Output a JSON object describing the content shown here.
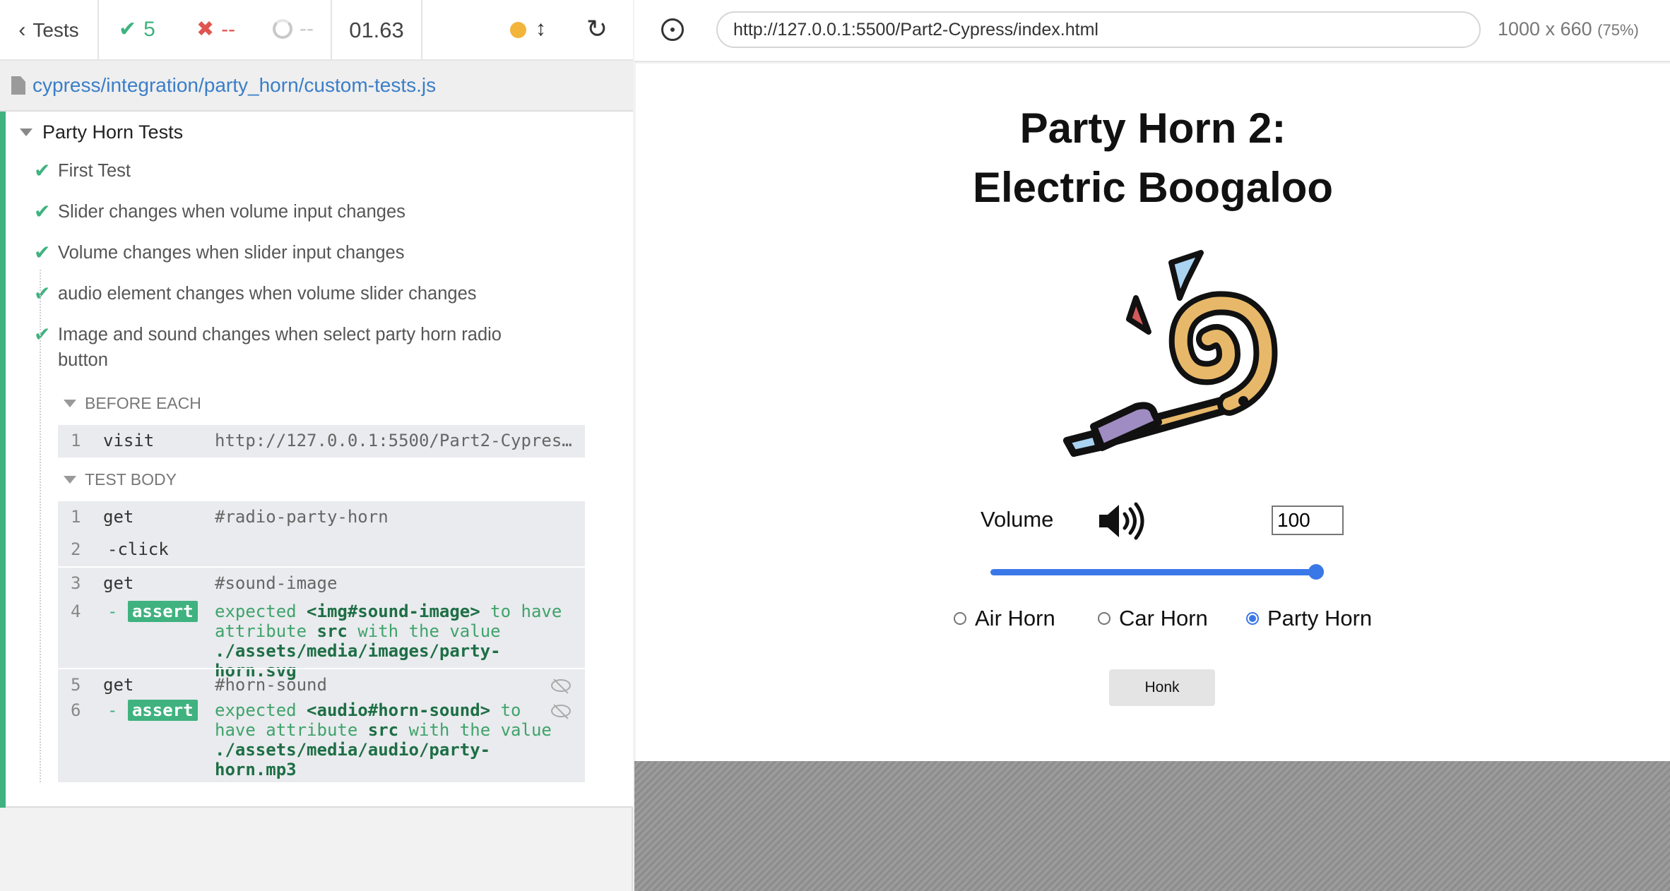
{
  "topbar": {
    "tests_label": "Tests",
    "passed": "5",
    "failed": "--",
    "pending": "--",
    "duration": "01.63"
  },
  "spec": {
    "path": "cypress/integration/party_horn/custom-tests.js"
  },
  "suite": {
    "title": "Party Horn Tests",
    "tests": [
      "First Test",
      "Slider changes when volume input changes",
      "Volume changes when slider input changes",
      "audio element changes when volume slider changes",
      "Image and sound changes when select party horn radio button"
    ]
  },
  "hooks": {
    "before_each_title": "BEFORE EACH",
    "test_body_title": "TEST BODY",
    "before_each_cmd": {
      "num": "1",
      "name": "visit",
      "msg": "http://127.0.0.1:5500/Part2-Cypress/index.html"
    },
    "commands": [
      {
        "num": "1",
        "name": "get",
        "msg": "#radio-party-horn"
      },
      {
        "num": "2",
        "name": "-click",
        "msg": ""
      },
      {
        "num": "3",
        "name": "get",
        "msg": "#sound-image"
      },
      {
        "num": "4",
        "name": "assert",
        "prefix": "-",
        "msg_a": "expected",
        "msg_b": "<img#sound-image>",
        "msg_c": "to have attribute",
        "msg_d": "src",
        "msg_e": "with the value",
        "msg_f": "./assets/media/images/party-horn.svg"
      },
      {
        "num": "5",
        "name": "get",
        "msg": "#horn-sound"
      },
      {
        "num": "6",
        "name": "assert",
        "prefix": "-",
        "msg_a": "expected",
        "msg_b": "<audio#horn-sound>",
        "msg_c": "to have attribute",
        "msg_d": "src",
        "msg_e": "with the value",
        "msg_f": "./assets/media/audio/party-horn.mp3"
      }
    ]
  },
  "aut": {
    "url": "http://127.0.0.1:5500/Part2-Cypress/index.html",
    "viewport": "1000 x 660",
    "zoom": "(75%)"
  },
  "app": {
    "title_line1": "Party Horn 2:",
    "title_line2": "Electric Boogaloo",
    "volume_label": "Volume",
    "volume_value": "100",
    "volume_level": 1.0,
    "radios": [
      {
        "label": "Air Horn",
        "checked": false
      },
      {
        "label": "Car Horn",
        "checked": false
      },
      {
        "label": "Party Horn",
        "checked": true
      }
    ],
    "honk_label": "Honk"
  },
  "icons": {
    "back": "chevron-left-icon",
    "pass": "check-icon",
    "fail": "x-icon",
    "pending": "spinner-icon",
    "running": "status-dot-icon",
    "scroll": "updown-arrow-icon",
    "reload": "reload-icon",
    "selector": "crosshair-icon",
    "file": "file-icon",
    "hidden": "eye-slash-icon",
    "volume": "volume-high-icon",
    "image": "party-horn-image"
  },
  "colors": {
    "pass": "#3fb27f",
    "fail": "#e0564f",
    "running": "#f3b43b",
    "link": "#3a7ec8",
    "accent": "#3b78e7"
  }
}
